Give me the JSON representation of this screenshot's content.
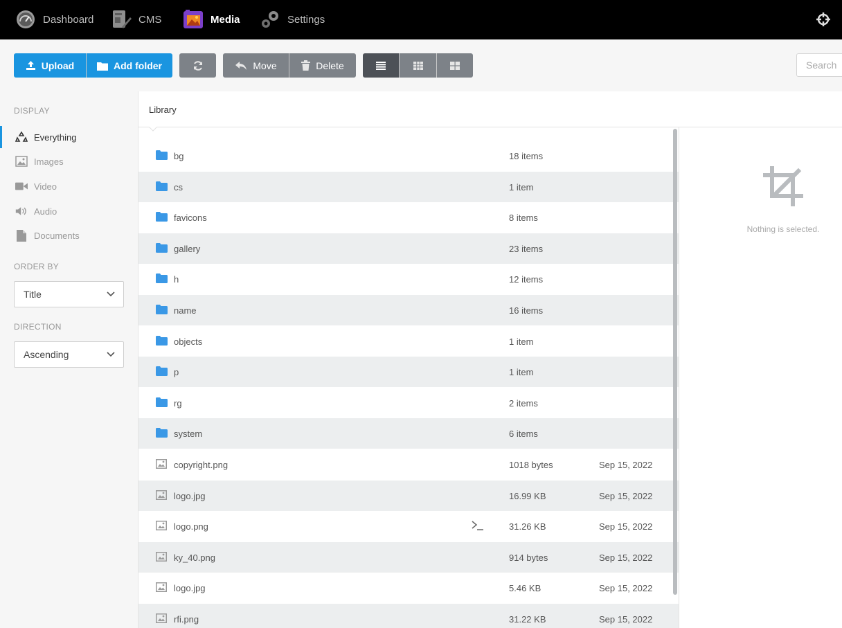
{
  "nav": {
    "items": [
      {
        "label": "Dashboard",
        "icon": "dashboard-gauge-icon"
      },
      {
        "label": "CMS",
        "icon": "cms-edit-icon"
      },
      {
        "label": "Media",
        "icon": "media-image-icon",
        "active": true
      },
      {
        "label": "Settings",
        "icon": "settings-gears-icon"
      }
    ],
    "right_icon": "crosshair-icon"
  },
  "toolbar": {
    "upload_label": "Upload",
    "add_folder_label": "Add folder",
    "refresh_icon": "refresh-icon",
    "move_label": "Move",
    "delete_label": "Delete",
    "view_modes": [
      "list-view-icon",
      "grid-small-view-icon",
      "grid-large-view-icon"
    ],
    "search_placeholder": "Search"
  },
  "sidebar": {
    "display_title": "DISPLAY",
    "display_items": [
      {
        "label": "Everything",
        "icon": "recycle-icon",
        "active": true
      },
      {
        "label": "Images",
        "icon": "image-icon"
      },
      {
        "label": "Video",
        "icon": "video-icon"
      },
      {
        "label": "Audio",
        "icon": "audio-icon"
      },
      {
        "label": "Documents",
        "icon": "document-icon"
      }
    ],
    "order_title": "ORDER BY",
    "order_value": "Title",
    "direction_title": "DIRECTION",
    "direction_value": "Ascending"
  },
  "content": {
    "breadcrumb": "Library",
    "rows": [
      {
        "type": "folder",
        "name": "bg",
        "size": "18 items",
        "date": ""
      },
      {
        "type": "folder",
        "name": "cs",
        "size": "1 item",
        "date": ""
      },
      {
        "type": "folder",
        "name": "favicons",
        "size": "8 items",
        "date": ""
      },
      {
        "type": "folder",
        "name": "gallery",
        "size": "23 items",
        "date": ""
      },
      {
        "type": "folder",
        "name": "h",
        "size": "12 items",
        "date": ""
      },
      {
        "type": "folder",
        "name": "name",
        "size": "16 items",
        "date": ""
      },
      {
        "type": "folder",
        "name": "objects",
        "size": "1 item",
        "date": ""
      },
      {
        "type": "folder",
        "name": "p",
        "size": "1 item",
        "date": ""
      },
      {
        "type": "folder",
        "name": "rg",
        "size": "2 items",
        "date": ""
      },
      {
        "type": "folder",
        "name": "system",
        "size": "6 items",
        "date": ""
      },
      {
        "type": "image",
        "name": "copyright.png",
        "size": "1018 bytes",
        "date": "Sep 15, 2022"
      },
      {
        "type": "image",
        "name": "logo.jpg",
        "size": "16.99 KB",
        "date": "Sep 15, 2022"
      },
      {
        "type": "image",
        "name": "logo.png",
        "size": "31.26 KB",
        "date": "Sep 15, 2022",
        "terminal": true
      },
      {
        "type": "image",
        "name": "ky_40.png",
        "size": "914 bytes",
        "date": "Sep 15, 2022"
      },
      {
        "type": "image",
        "name": "logo.jpg",
        "size": "5.46 KB",
        "date": "Sep 15, 2022"
      },
      {
        "type": "image",
        "name": "rfi.png",
        "size": "31.22 KB",
        "date": "Sep 15, 2022"
      }
    ]
  },
  "detail": {
    "icon": "crop-icon",
    "empty_text": "Nothing is selected."
  },
  "colors": {
    "accent": "#1a95e0",
    "folder": "#3a98e6",
    "nav_bg": "#000000",
    "row_alt": "#eceeef"
  }
}
